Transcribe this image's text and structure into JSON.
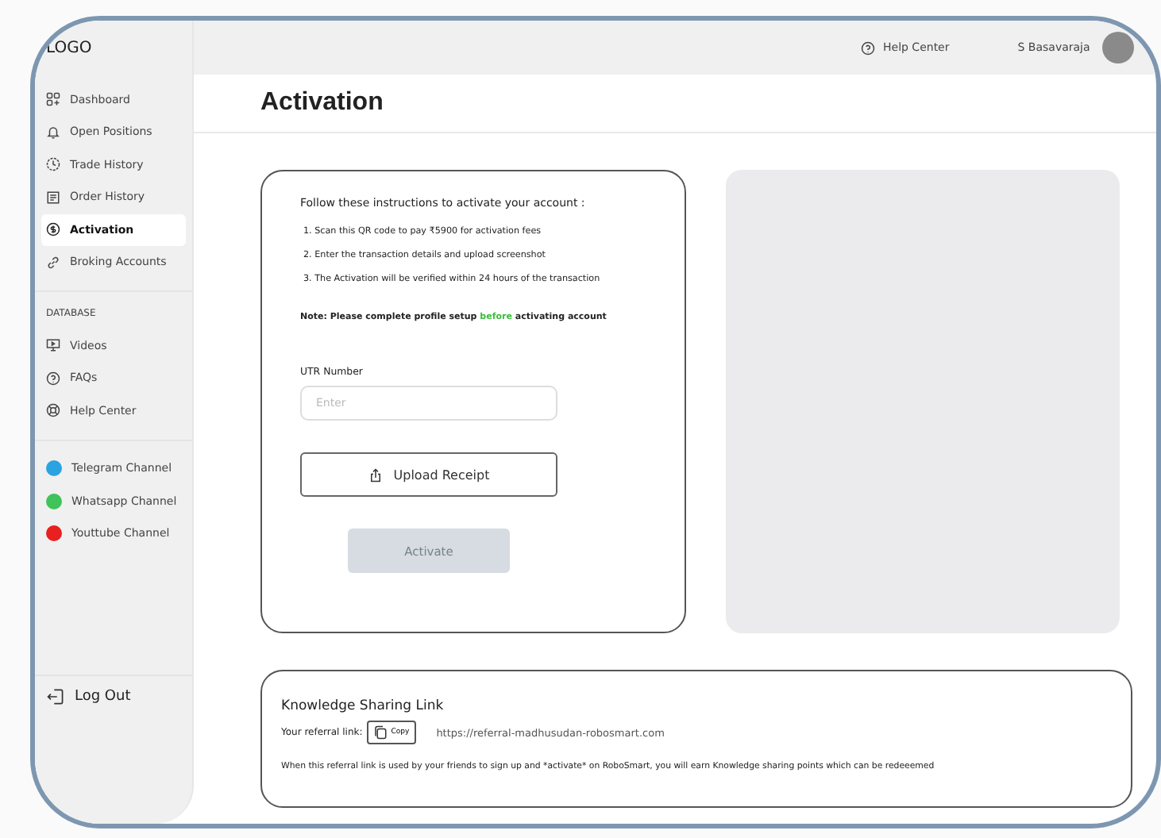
{
  "logo": "LOGO",
  "topbar": {
    "help": "Help Center",
    "user": "S Basavaraja"
  },
  "sidebar": {
    "items": [
      {
        "label": "Dashboard",
        "selected": false
      },
      {
        "label": "Open Positions",
        "selected": false
      },
      {
        "label": "Trade History",
        "selected": false
      },
      {
        "label": "Order History",
        "selected": false
      },
      {
        "label": "Activation",
        "selected": true
      },
      {
        "label": "Broking Accounts",
        "selected": false
      }
    ],
    "section": "DATABASE",
    "database": [
      {
        "label": "Videos"
      },
      {
        "label": "FAQs"
      },
      {
        "label": "Help Center"
      }
    ],
    "channels": [
      {
        "label": "Telegram Channel",
        "color": "#2aa3e0"
      },
      {
        "label": "Whatsapp Channel",
        "color": "#3fc35a"
      },
      {
        "label": "Youttube Channel",
        "color": "#e82020"
      }
    ],
    "logout": "Log Out"
  },
  "page_title": "Activation",
  "instructions": {
    "heading": "Follow these instructions to activate your account :",
    "steps": [
      "1. Scan this QR code to pay ₹5900 for activation fees",
      "2. Enter the transaction details and upload screenshot",
      "3. The Activation will be verified within 24 hours of the transaction"
    ],
    "note": "**Note: Please complete profile setup** before **activating account**"
  },
  "utr": {
    "label": "UTR Number",
    "placeholder": "Enter"
  },
  "upload_button": "Upload Receipt",
  "activate_button": {
    "label": "Activate",
    "disabled": true
  },
  "referral": {
    "title": "Knowledge Sharing Link",
    "label": "Your referral link:",
    "copy": "Copy",
    "link": "https://referral-madhusudan-robosmart.com",
    "description": "When this referral link is used by your friends to sign up  and *activate* on RoboSmart, you will earn Knowledge sharing points which can be redeeemed"
  }
}
